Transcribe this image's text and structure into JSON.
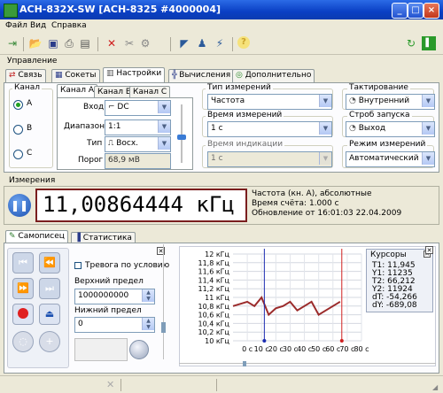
{
  "window": {
    "title": "АСН-832X-SW [АСН-8325 #4000004]"
  },
  "menu": [
    "Файл",
    "Вид",
    "Справка"
  ],
  "sections": {
    "control": "Управление",
    "measurement": "Измерения"
  },
  "main_tabs": [
    "Связь",
    "Сокеты",
    "Настройки",
    "Вычисления",
    "Дополнительно"
  ],
  "channel": {
    "title": "Канал",
    "options": [
      "A",
      "B",
      "C"
    ],
    "selected": "A",
    "subtabs": [
      "Канал A",
      "Канал B",
      "Канал C"
    ],
    "input_label": "Вход",
    "input_value": "DC",
    "range_label": "Диапазон",
    "range_value": "1:1",
    "type_label": "Тип",
    "type_value": "Восх.",
    "threshold_label": "Порог",
    "threshold_value": "68,9 мВ"
  },
  "measure_type": {
    "label": "Тип измерений",
    "value": "Частота"
  },
  "measure_time": {
    "label": "Время измерений",
    "value": "1 с"
  },
  "indication_time": {
    "label": "Время индикации",
    "value": "1 с"
  },
  "clocking": {
    "label": "Тактирование",
    "value": "Внутренний"
  },
  "strobe": {
    "label": "Строб запуска",
    "value": "Выход"
  },
  "mode": {
    "label": "Режим измерений",
    "value": "Автоматический"
  },
  "display": {
    "value": "11,00864444 кГц",
    "info1": "Частота (кн. A), абсолютные",
    "info2": "Время счёта: 1.000 с",
    "info3": "Обновление от 16:01:03 22.04.2009"
  },
  "bottom_tabs": [
    "Самописец",
    "Статистика"
  ],
  "recorder": {
    "alarm_label": "Тревога по условию",
    "upper_label": "Верхний предел",
    "upper_value": "1000000000",
    "lower_label": "Нижний предел",
    "lower_value": "0"
  },
  "cursors": {
    "title": "Курсоры",
    "lines": [
      "T1: 11,945",
      "Y1: 11235",
      "T2: 66,212",
      "Y2: 11924",
      "dT: -54,266",
      "dY: -689,08"
    ]
  },
  "chart_data": {
    "type": "line",
    "y_ticks": [
      "12 кГц",
      "11,8 кГц",
      "11,6 кГц",
      "11,4 кГц",
      "11,2 кГц",
      "11 кГц",
      "10,8 кГц",
      "10,6 кГц",
      "10,4 кГц",
      "10,2 кГц",
      "10 кГц"
    ],
    "x_ticks": [
      "0 с",
      "10 с",
      "20 с",
      "30 с",
      "40 с",
      "50 с",
      "60 с",
      "70 с",
      "80 с"
    ],
    "ylim": [
      10,
      12
    ],
    "xlim": [
      -10,
      80
    ],
    "series": [
      {
        "x": [
          -10,
          0,
          5,
          10,
          15,
          20,
          25,
          30,
          35,
          40,
          45,
          50,
          55,
          60,
          65
        ],
        "y": [
          10.8,
          10.9,
          10.8,
          11.0,
          10.6,
          10.75,
          10.8,
          10.9,
          10.7,
          10.8,
          10.9,
          10.6,
          10.7,
          10.8,
          10.9
        ]
      }
    ],
    "colors": {
      "line": "#9b2b2b",
      "cursor1": "#1a2bb0",
      "cursor2": "#d02020"
    }
  }
}
